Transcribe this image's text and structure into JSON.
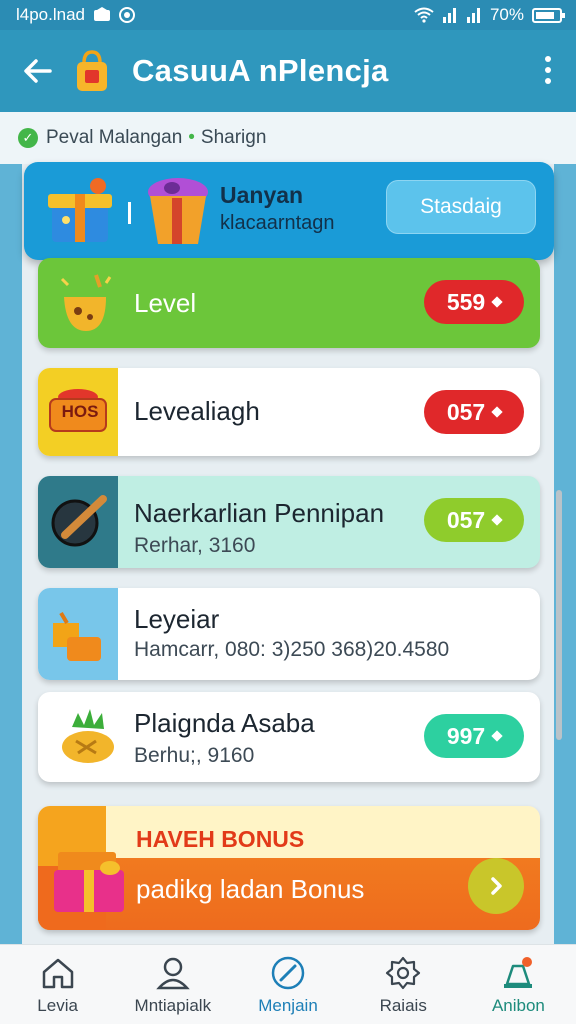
{
  "status_bar": {
    "left_text": "l4po.lnad",
    "battery": "70%"
  },
  "app_bar": {
    "title": "CasuuA nPlencja"
  },
  "breadcrumb": {
    "item1": "Peval Malangan",
    "separator": "•",
    "item2": "Sharign"
  },
  "top_card": {
    "title": "Uanyan",
    "subtitle": "klacaarntagn",
    "button": "Stasdaig"
  },
  "items": [
    {
      "title": "Level",
      "subtitle": "",
      "value": "559",
      "value_color": "#e0282a"
    },
    {
      "title": "Levealiagh",
      "subtitle": "",
      "value": "057",
      "value_color": "#e0282a",
      "thumb_text": "HOS"
    },
    {
      "title": "Naerkarlian Pennipan",
      "subtitle": "Rerhar, 3160",
      "value": "057",
      "value_color": "#8fcc2c"
    },
    {
      "title": "Leyeiar",
      "subtitle": "Hamcarr, 080: 3)250 368)20.4580",
      "value": "",
      "value_color": ""
    },
    {
      "title": "Plaignda Asaba",
      "subtitle": "Berhu;, 9160",
      "value": "997",
      "value_color": "#2dd0a0"
    }
  ],
  "bonus": {
    "title": "HAVEH BONUS",
    "subtitle": "padikg ladan Bonus"
  },
  "bottom_nav": [
    {
      "label": "Levia",
      "icon": "home-icon"
    },
    {
      "label": "Mntiapialk",
      "icon": "profile-icon"
    },
    {
      "label": "Menjain",
      "icon": "compass-icon"
    },
    {
      "label": "Raiais",
      "icon": "settings-icon"
    },
    {
      "label": "Anibon",
      "icon": "badge-icon"
    }
  ],
  "colors": {
    "primary": "#2f97bd",
    "accent": "#1a9bd7"
  }
}
